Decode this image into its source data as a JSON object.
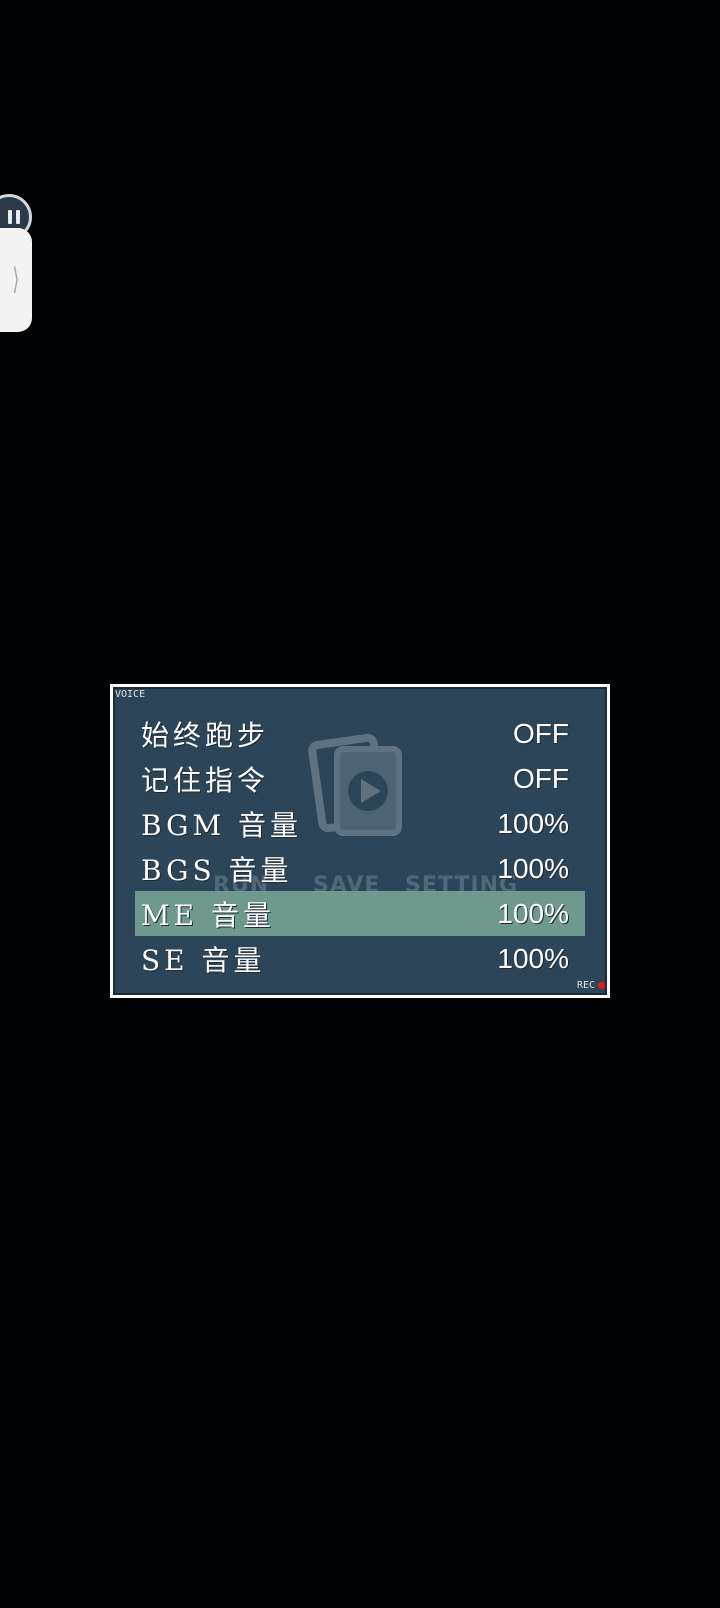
{
  "overlay": {
    "chevron_glyph": "⟩"
  },
  "window": {
    "corner_label": "VOICE",
    "rec_label": "REC",
    "background_color": "#2d4558",
    "selection_color": "#6e998c",
    "ghost_texts": [
      "RUN",
      "SAVE",
      "SETTING"
    ]
  },
  "options": [
    {
      "label": "始终跑步",
      "value": "OFF",
      "selected": false
    },
    {
      "label": "记住指令",
      "value": "OFF",
      "selected": false
    },
    {
      "label": "BGM 音量",
      "value": "100%",
      "selected": false
    },
    {
      "label": "BGS 音量",
      "value": "100%",
      "selected": false
    },
    {
      "label": "ME 音量",
      "value": "100%",
      "selected": true
    },
    {
      "label": "SE 音量",
      "value": "100%",
      "selected": false
    }
  ]
}
